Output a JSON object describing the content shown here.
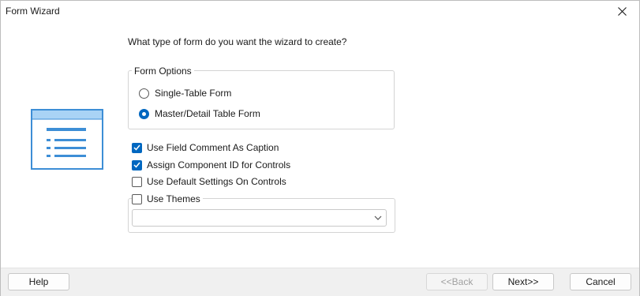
{
  "window": {
    "title": "Form Wizard"
  },
  "question": "What type of form do you want the wizard to create?",
  "form_options": {
    "legend": "Form Options",
    "options": [
      {
        "label": "Single-Table Form",
        "selected": false
      },
      {
        "label": "Master/Detail Table Form",
        "selected": true
      }
    ]
  },
  "checkboxes": [
    {
      "label": "Use Field Comment As Caption",
      "checked": true
    },
    {
      "label": "Assign Component ID for Controls",
      "checked": true
    },
    {
      "label": "Use Default Settings On Controls",
      "checked": false
    }
  ],
  "themes": {
    "label": "Use Themes",
    "checked": false,
    "selected_value": ""
  },
  "buttons": {
    "help": "Help",
    "back": "<<Back",
    "next": "Next>>",
    "cancel": "Cancel"
  },
  "colors": {
    "accent": "#0067c0",
    "illustration": "#3d8ed6",
    "illustration_header": "#a9d3f5"
  }
}
